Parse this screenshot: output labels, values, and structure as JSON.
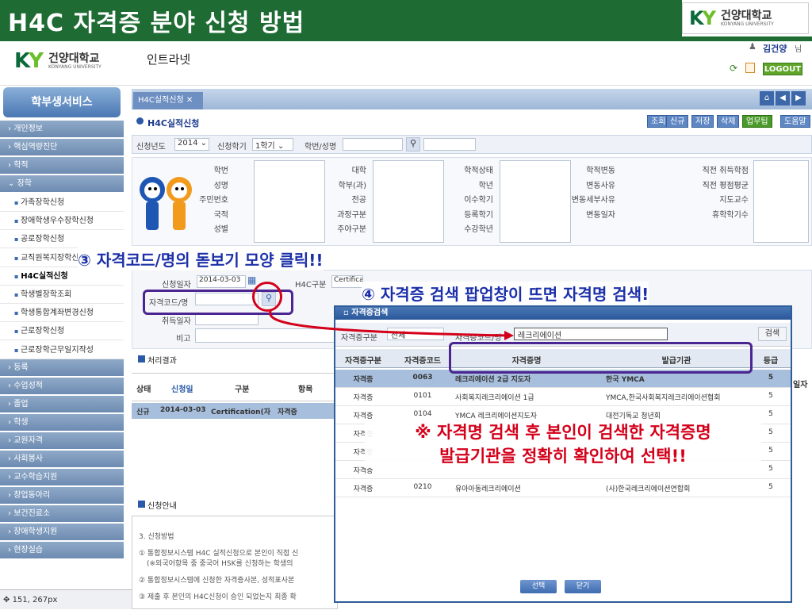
{
  "slide": {
    "title": "H4C 자격증 분야 신청 방법",
    "logo_text": "건양대학교",
    "logo_en": "KONYANG UNIVERSITY"
  },
  "app": {
    "logo_text": "건양대학교",
    "logo_en": "KONYANG UNIVERSITY",
    "intranet": "인트라넷",
    "user": "김건양",
    "user_suffix": "님",
    "logout": "LOGOUT"
  },
  "sidebar": {
    "title": "학부생서비스",
    "items": [
      {
        "label": "개인정보",
        "type": "menu"
      },
      {
        "label": "핵심역량진단",
        "type": "menu"
      },
      {
        "label": "학적",
        "type": "menu"
      },
      {
        "label": "장학",
        "type": "menu"
      },
      {
        "label": "가족장학신청",
        "type": "sub"
      },
      {
        "label": "장애학생우수장학신청",
        "type": "sub"
      },
      {
        "label": "공로장학신청",
        "type": "sub"
      },
      {
        "label": "교직원복지장학신청",
        "type": "sub"
      },
      {
        "label": "H4C실적신청",
        "type": "sub",
        "active": true
      },
      {
        "label": "학생별장학조회",
        "type": "sub"
      },
      {
        "label": "학생통합계좌변경신청",
        "type": "sub"
      },
      {
        "label": "근로장학신청",
        "type": "sub"
      },
      {
        "label": "근로장학근무일지작성",
        "type": "sub"
      },
      {
        "label": "등록",
        "type": "menu"
      },
      {
        "label": "수업성적",
        "type": "menu"
      },
      {
        "label": "졸업",
        "type": "menu"
      },
      {
        "label": "학생",
        "type": "menu"
      },
      {
        "label": "교원자격",
        "type": "menu"
      },
      {
        "label": "사회봉사",
        "type": "menu"
      },
      {
        "label": "교수학습지원",
        "type": "menu"
      },
      {
        "label": "창업동아리",
        "type": "menu"
      },
      {
        "label": "보건진료소",
        "type": "menu"
      },
      {
        "label": "장애학생지원",
        "type": "menu"
      },
      {
        "label": "현장실습",
        "type": "menu"
      }
    ]
  },
  "content": {
    "tab": "H4C실적신청",
    "heading": "H4C실적신청",
    "toolbar": [
      "조회",
      "신규",
      "저장",
      "삭제",
      "업무팁",
      "도움말"
    ],
    "filter": {
      "year_label": "신청년도",
      "year": "2014",
      "term_label": "신청학기",
      "term": "1학기",
      "student_label": "학번/성명"
    },
    "info_labels": {
      "col1": [
        "학번",
        "성명",
        "주민번호",
        "국적",
        "성별"
      ],
      "col2": [
        "대학",
        "학부(과)",
        "전공",
        "과정구분",
        "주야구분"
      ],
      "col3": [
        "학적상태",
        "학년",
        "이수학기",
        "등록학기",
        "수강학년"
      ],
      "col4": [
        "학적변동",
        "변동사유",
        "변동세부사유",
        "변동일자"
      ],
      "col5": [
        "직전 취득학점",
        "직전 평점평균",
        "지도교수",
        "휴학학기수"
      ]
    },
    "form": {
      "date_label": "신청일자",
      "date": "2014-03-03",
      "h4c_label": "H4C구분",
      "h4c_value": "Certifica",
      "code_label": "자격코드/명",
      "date2_label": "취득일자",
      "remark_label": "비고"
    },
    "result_heading": "처리결과",
    "result_headers": [
      "상태",
      "신청일",
      "구분",
      "항목"
    ],
    "result_row": [
      "신규",
      "2014-03-03",
      "Certification(자",
      "자격증"
    ],
    "guide_heading": "신청안내",
    "guide_lines": [
      "3. 신청방법",
      "① 통합정보시스템 H4C 실적신청으로 본인이 직접 신",
      "(※외국어항목 중 중국어 HSK를 신청하는 학생의",
      "② 통합정보시스템에 신청한 자격증사본, 성적표사본",
      "③ 제출 후 본인의 H4C신청이 승인 되었는지 최종 확"
    ],
    "status_bar": "151, 267px"
  },
  "popup": {
    "title": "자격증검색",
    "search_type_label": "자격증구분",
    "search_type": "전체",
    "code_label": "자격증코드/명",
    "keyword": "레크리에이션",
    "search_button": "검색",
    "headers": [
      "자격증구분",
      "자격증코드",
      "자격증명",
      "발급기관",
      "등급"
    ],
    "rows": [
      [
        "자격증",
        "0063",
        "레크리에이션 2급 지도자",
        "한국 YMCA",
        "5"
      ],
      [
        "자격증",
        "0101",
        "사회복지레크리에이션 1급",
        "YMCA,한국사회복지레크리에이션협회",
        "5"
      ],
      [
        "자격증",
        "0104",
        "YMCA 레크리에이션지도자",
        "대전기독교 청년회",
        "5"
      ],
      [
        "자격증",
        "",
        "",
        "",
        "5"
      ],
      [
        "자격증",
        "",
        "",
        "",
        "5"
      ],
      [
        "자격증",
        "",
        "",
        "",
        "5"
      ],
      [
        "자격증",
        "0210",
        "유아아동레크리에이션",
        "(사)한국레크리에이션연합회",
        "5"
      ]
    ],
    "select_button": "선택",
    "close_button": "닫기",
    "extra_col": "일자"
  },
  "annotations": {
    "step3": "③ 자격코드/명의 돋보기 모양 클릭!!",
    "step4": "④ 자격증 검색 팝업창이 뜨면 자격명 검색!",
    "warning_line1": "※ 자격명 검색 후 본인이 검색한 자격증명",
    "warning_line2": "발급기관을 정확히 확인하여 선택!!"
  },
  "colors": {
    "slide_green": "#1e6b33",
    "accent_blue": "#1b2fa8",
    "warning_red": "#d4001a",
    "highlight_purple": "#4b2690"
  }
}
